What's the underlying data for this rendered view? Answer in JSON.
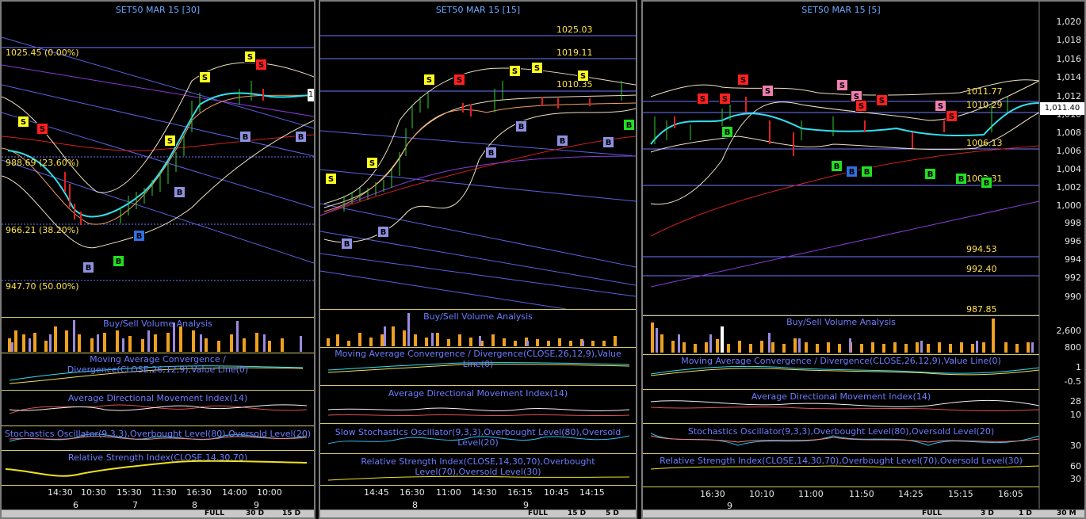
{
  "panels": [
    {
      "title": "SET50 MAR 15   [30]",
      "price_labels": [
        "1025.45 (0.00%)",
        "988.69 (23.60%)",
        "966.21 (38.20%)",
        "947.70 (50.00%)"
      ],
      "indicators": [
        "Buy/Sell Volume Analysis",
        "Moving Average Convergence / Divergence(CLOSE,26,12,9),Value Line(0)",
        "Average Directional Movement Index(14)",
        "Stochastics Oscillator(9,3,3),Overbought Level(80),Oversold Level(20)",
        "Relative Strength Index(CLOSE,14,30,70)"
      ],
      "times": [
        "14:30",
        "10:30",
        "15:30",
        "11:30",
        "16:30",
        "14:00",
        "10:00"
      ],
      "days": [
        "6",
        "7",
        "8",
        "9"
      ],
      "last_value": "1",
      "signals": [
        "S",
        "S",
        "S",
        "S",
        "S",
        "S",
        "S",
        "B",
        "B",
        "B",
        "B",
        "B",
        "B"
      ],
      "buttons": [
        "FULL",
        "30 D",
        "15 D"
      ]
    },
    {
      "title": "SET50 MAR 15   [15]",
      "price_labels": [
        "1025.03",
        "1019.11",
        "1010.35"
      ],
      "indicators": [
        "Buy/Sell Volume Analysis",
        "Moving Average Convergence / Divergence(CLOSE,26,12,9),Value Line(0)",
        "Average Directional Movement Index(14)",
        "Slow Stochastics Oscillator(9,3,3),Overbought Level(80),Oversold Level(20)",
        "Relative Strength Index(CLOSE,14,30,70),Overbought Level(70),Oversold Level(30)"
      ],
      "times": [
        "14:45",
        "16:30",
        "11:00",
        "14:30",
        "16:15",
        "10:45",
        "14:15"
      ],
      "days": [
        "8",
        "9"
      ],
      "signals": [
        "S",
        "S",
        "S",
        "S",
        "S",
        "S",
        "S",
        "B",
        "B",
        "B",
        "B",
        "B",
        "B",
        "B"
      ],
      "buttons": [
        "FULL",
        "15 D",
        "5 D"
      ]
    },
    {
      "title": "SET50 MAR 15   [5]",
      "price_labels": [
        "1011.77",
        "1010.29",
        "1006.13",
        "1002.31",
        "994.53",
        "992.40",
        "987.85"
      ],
      "y_axis": [
        "1,020",
        "1,018",
        "1,016",
        "1,014",
        "1,012",
        "1,010",
        "1,008",
        "1,006",
        "1,004",
        "1,002",
        "1,000",
        "998",
        "996",
        "994",
        "992",
        "990"
      ],
      "last_value": "1,011.40",
      "indicators": [
        "Buy/Sell Volume Analysis",
        "Moving Average Convergence / Divergence(CLOSE,26,12,9),Value Line(0)",
        "Average Directional Movement Index(14)",
        "Stochastics Oscillator(9,3,3),Overbought Level(80),Oversold Level(20)",
        "Relative Strength Index(CLOSE,14,30,70),Overbought Level(70),Oversold Level(30)"
      ],
      "ind_axis": [
        "2,600",
        "800",
        "1",
        "-0.5",
        "28",
        "10",
        "30",
        "60",
        "30"
      ],
      "times": [
        "16:30",
        "10:10",
        "11:00",
        "11:50",
        "14:25",
        "15:15",
        "16:05"
      ],
      "days": [
        "9"
      ],
      "signals": [
        "S",
        "S",
        "S",
        "S",
        "S",
        "S",
        "S",
        "S",
        "S",
        "S",
        "B",
        "B",
        "B",
        "B",
        "B",
        "B",
        "B"
      ],
      "buttons": [
        "FULL",
        "3 D",
        "1 D",
        "30 M"
      ]
    }
  ],
  "colors": {
    "sell": "#ff2020",
    "sell_alt": "#ffff20",
    "buy": "#20e020",
    "buy_alt": "#9090e0",
    "price_label": "#ffe24a",
    "indicator_title": "#6d7cff"
  }
}
